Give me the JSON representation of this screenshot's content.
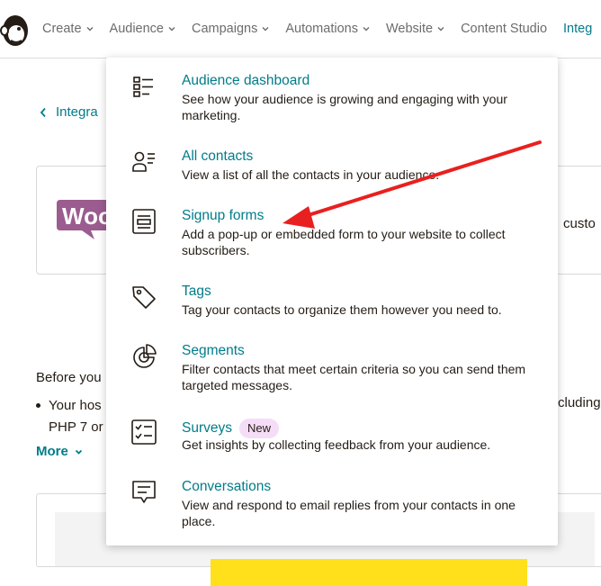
{
  "nav": {
    "items": [
      {
        "label": "Create",
        "chevron": true
      },
      {
        "label": "Audience",
        "chevron": true
      },
      {
        "label": "Campaigns",
        "chevron": true
      },
      {
        "label": "Automations",
        "chevron": true
      },
      {
        "label": "Website",
        "chevron": true
      },
      {
        "label": "Content Studio",
        "chevron": false
      },
      {
        "label": "Integ",
        "chevron": false
      }
    ]
  },
  "background": {
    "back_link": "Integra",
    "card_logo": "Woo",
    "right_fragment": "custo",
    "before_text": "Before you",
    "bullet_line1": "Your hos",
    "bullet_line2": "PHP 7 or",
    "bullet_right": "cluding",
    "more_label": "More"
  },
  "dropdown": {
    "items": [
      {
        "icon": "dashboard-list-icon",
        "title": "Audience dashboard",
        "desc": "See how your audience is growing and engaging with your marketing."
      },
      {
        "icon": "contacts-icon",
        "title": "All contacts",
        "desc": "View a list of all the contacts in your audience."
      },
      {
        "icon": "signup-form-icon",
        "title": "Signup forms",
        "desc": "Add a pop-up or embedded form to your website to collect subscribers."
      },
      {
        "icon": "tag-icon",
        "title": "Tags",
        "desc": "Tag your contacts to organize them however you need to."
      },
      {
        "icon": "segments-pie-icon",
        "title": "Segments",
        "desc": "Filter contacts that meet certain criteria so you can send them targeted messages."
      },
      {
        "icon": "survey-checklist-icon",
        "title": "Surveys",
        "badge": "New",
        "desc": "Get insights by collecting feedback from your audience."
      },
      {
        "icon": "chat-bubble-icon",
        "title": "Conversations",
        "desc": "View and respond to email replies from your contacts in one place."
      }
    ]
  },
  "colors": {
    "link": "#007c89",
    "text": "#241c15",
    "badge_bg": "#f5ddf7",
    "arrow": "#e8201f",
    "woo": "#9b5c8f"
  }
}
